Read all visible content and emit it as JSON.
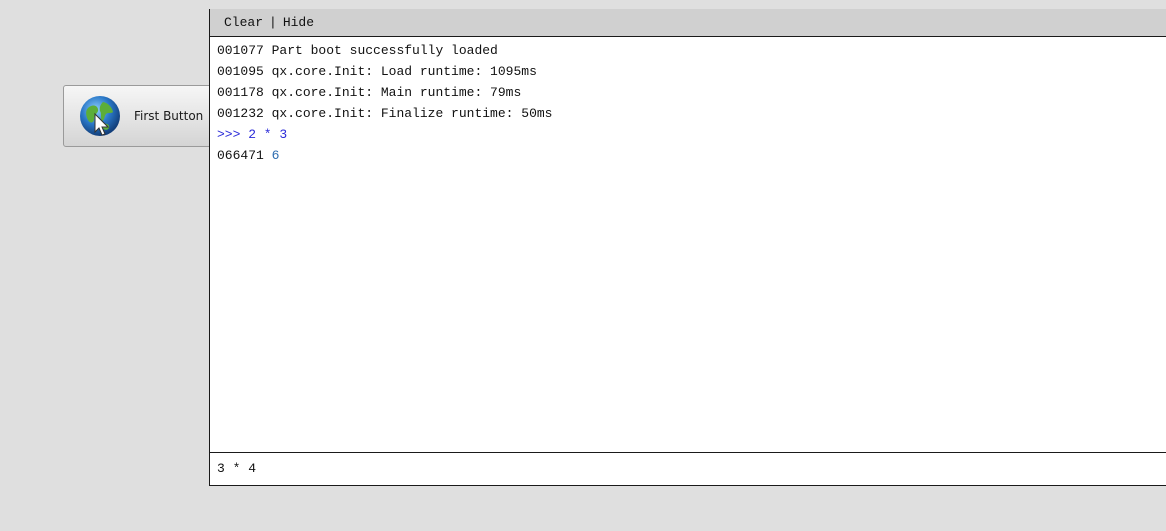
{
  "background_app": {
    "first_button_label": "First Button",
    "first_button_icon": "globe-cursor-icon"
  },
  "console": {
    "toolbar": {
      "clear_label": "Clear",
      "separator": "|",
      "hide_label": "Hide"
    },
    "log": [
      {
        "id": "001077",
        "text": "Part boot successfully loaded"
      },
      {
        "id": "001095",
        "text": "qx.core.Init: Load runtime: 1095ms"
      },
      {
        "id": "001178",
        "text": "qx.core.Init: Main runtime: 79ms"
      },
      {
        "id": "001232",
        "text": "qx.core.Init: Finalize runtime: 50ms"
      },
      {
        "command": ">>> 2 * 3"
      },
      {
        "id": "066471",
        "result": "6"
      }
    ],
    "input_value": "3 * 4"
  },
  "colors": {
    "command_text": "#2a2ad8",
    "result_text": "#2a6bb0",
    "toolbar_bg": "#d0d0d0",
    "page_bg": "#dfdfdf"
  }
}
